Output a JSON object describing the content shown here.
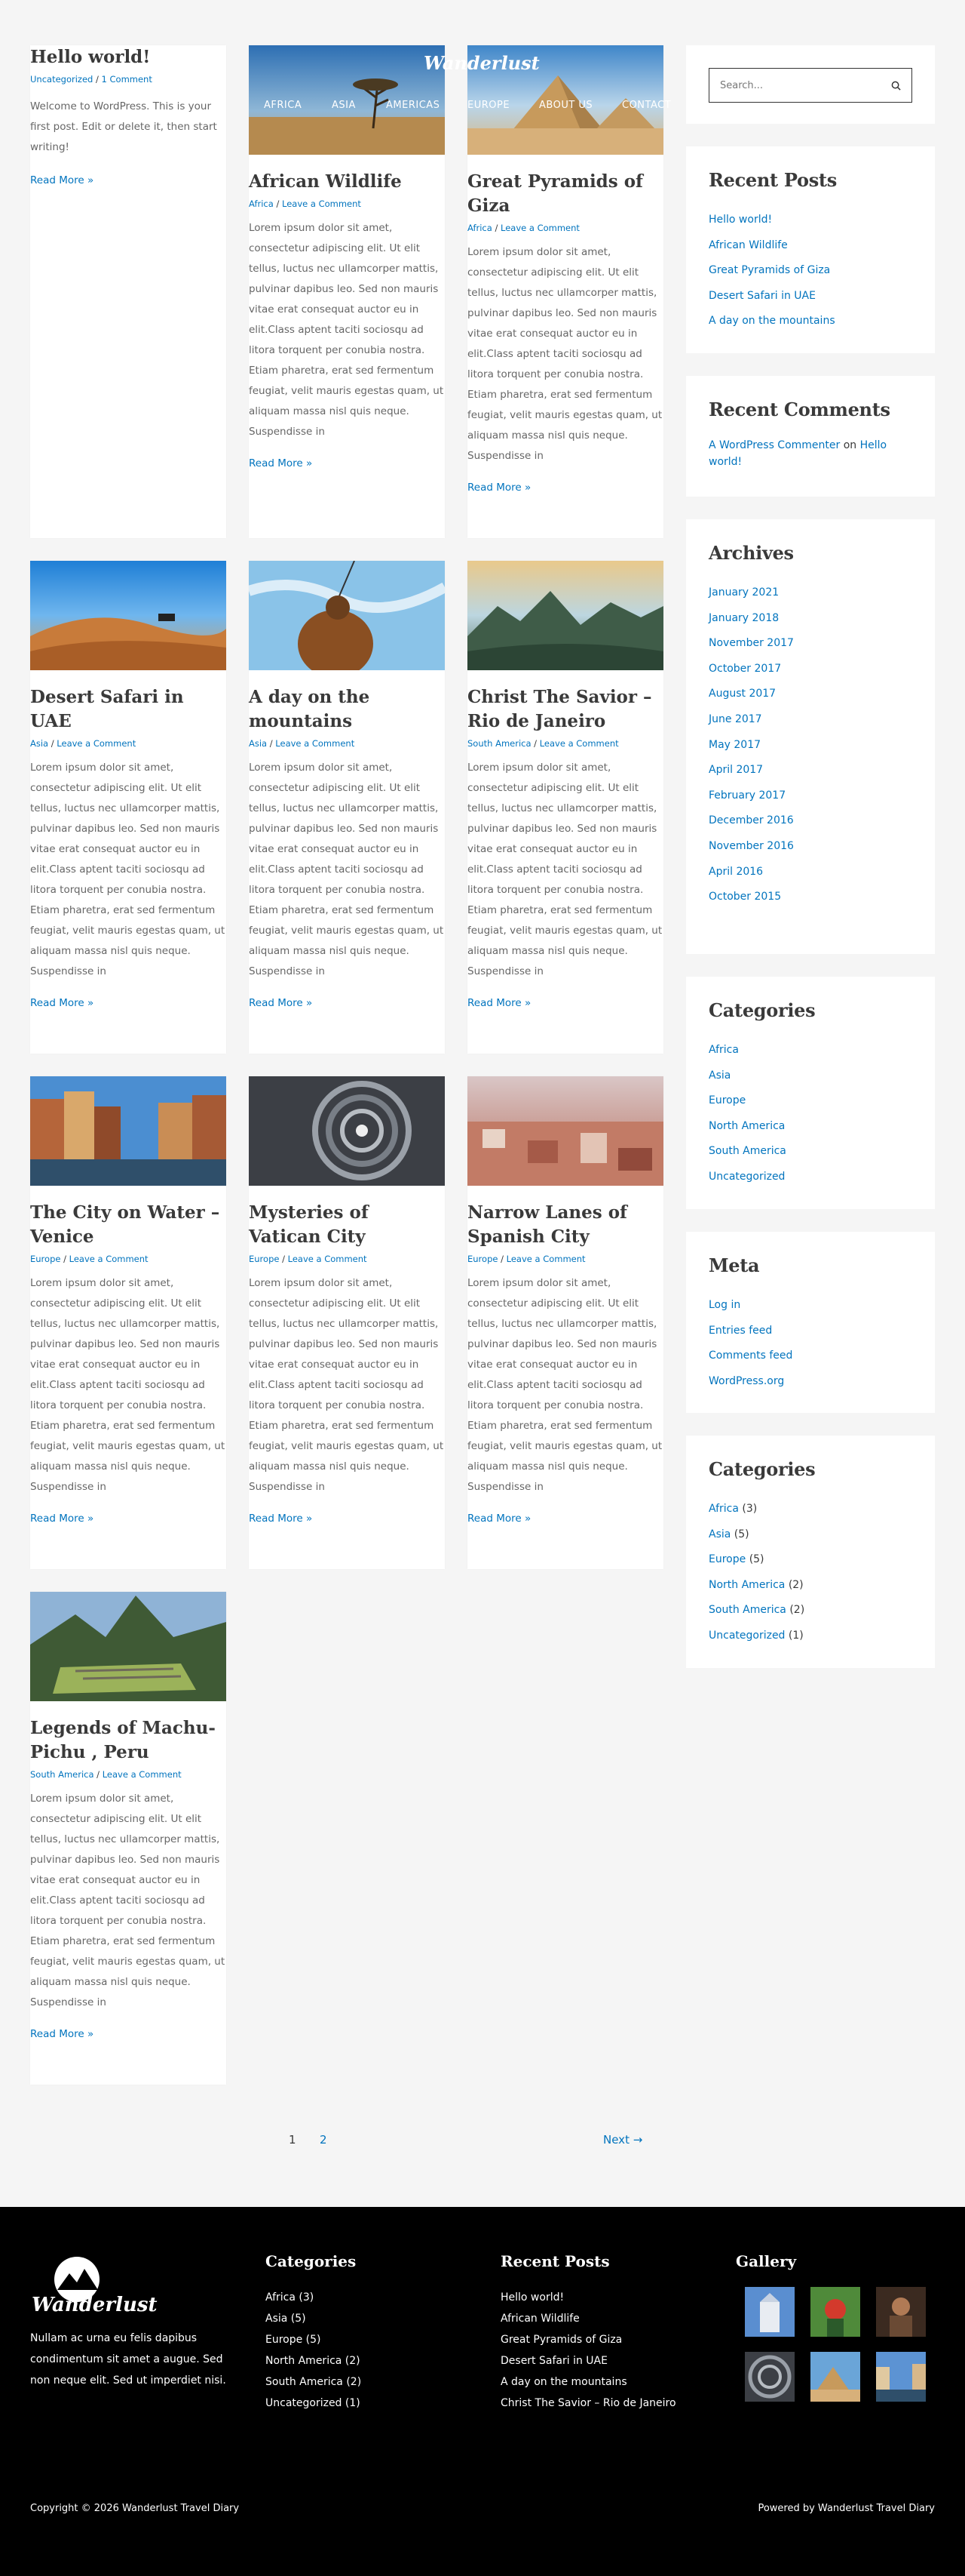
{
  "brand": {
    "logo_text": "Wanderlust"
  },
  "nav": {
    "items": [
      "AFRICA",
      "ASIA",
      "AMERICAS",
      "EUROPE",
      "ABOUT US",
      "CONTACT"
    ]
  },
  "posts": [
    {
      "title": "Hello world!",
      "categories": "Uncategorized",
      "comments": "1 Comment",
      "excerpt": "Welcome to WordPress. This is your first post. Edit or delete it, then start writing!",
      "more": "Read More »"
    },
    {
      "title": "African Wildlife",
      "categories": "Africa",
      "comments": "Leave a Comment",
      "excerpt": "Lorem ipsum dolor sit amet, consectetur adipiscing elit. Ut elit tellus, luctus nec ullamcorper mattis, pulvinar dapibus leo. Sed non mauris vitae erat consequat auctor eu in elit.Class aptent taciti sociosqu ad litora torquent per conubia nostra. Etiam pharetra, erat sed fermentum feugiat, velit mauris egestas quam, ut aliquam massa nisl quis neque. Suspendisse in",
      "more": "Read More »"
    },
    {
      "title": "Great Pyramids of Giza",
      "categories": "Africa",
      "comments": "Leave a Comment",
      "excerpt": "Lorem ipsum dolor sit amet, consectetur adipiscing elit. Ut elit tellus, luctus nec ullamcorper mattis, pulvinar dapibus leo. Sed non mauris vitae erat consequat auctor eu in elit.Class aptent taciti sociosqu ad litora torquent per conubia nostra. Etiam pharetra, erat sed fermentum feugiat, velit mauris egestas quam, ut aliquam massa nisl quis neque. Suspendisse in",
      "more": "Read More »"
    },
    {
      "title": "Desert Safari in UAE",
      "categories": "Asia",
      "comments": "Leave a Comment",
      "excerpt": "Lorem ipsum dolor sit amet, consectetur adipiscing elit. Ut elit tellus, luctus nec ullamcorper mattis, pulvinar dapibus leo. Sed non mauris vitae erat consequat auctor eu in elit.Class aptent taciti sociosqu ad litora torquent per conubia nostra. Etiam pharetra, erat sed fermentum feugiat, velit mauris egestas quam, ut aliquam massa nisl quis neque. Suspendisse in",
      "more": "Read More »"
    },
    {
      "title": "A day on the mountains",
      "categories": "Asia",
      "comments": "Leave a Comment",
      "excerpt": "Lorem ipsum dolor sit amet, consectetur adipiscing elit. Ut elit tellus, luctus nec ullamcorper mattis, pulvinar dapibus leo. Sed non mauris vitae erat consequat auctor eu in elit.Class aptent taciti sociosqu ad litora torquent per conubia nostra. Etiam pharetra, erat sed fermentum feugiat, velit mauris egestas quam, ut aliquam massa nisl quis neque. Suspendisse in",
      "more": "Read More »"
    },
    {
      "title": "Christ The Savior – Rio de Janeiro",
      "categories": "South America",
      "comments": "Leave a Comment",
      "excerpt": "Lorem ipsum dolor sit amet, consectetur adipiscing elit. Ut elit tellus, luctus nec ullamcorper mattis, pulvinar dapibus leo. Sed non mauris vitae erat consequat auctor eu in elit.Class aptent taciti sociosqu ad litora torquent per conubia nostra. Etiam pharetra, erat sed fermentum feugiat, velit mauris egestas quam, ut aliquam massa nisl quis neque. Suspendisse in",
      "more": "Read More »"
    },
    {
      "title": "The City on Water – Venice",
      "categories": "Europe",
      "comments": "Leave a Comment",
      "excerpt": "Lorem ipsum dolor sit amet, consectetur adipiscing elit. Ut elit tellus, luctus nec ullamcorper mattis, pulvinar dapibus leo. Sed non mauris vitae erat consequat auctor eu in elit.Class aptent taciti sociosqu ad litora torquent per conubia nostra. Etiam pharetra, erat sed fermentum feugiat, velit mauris egestas quam, ut aliquam massa nisl quis neque. Suspendisse in",
      "more": "Read More »"
    },
    {
      "title": "Mysteries of Vatican City",
      "categories": "Europe",
      "comments": "Leave a Comment",
      "excerpt": "Lorem ipsum dolor sit amet, consectetur adipiscing elit. Ut elit tellus, luctus nec ullamcorper mattis, pulvinar dapibus leo. Sed non mauris vitae erat consequat auctor eu in elit.Class aptent taciti sociosqu ad litora torquent per conubia nostra. Etiam pharetra, erat sed fermentum feugiat, velit mauris egestas quam, ut aliquam massa nisl quis neque. Suspendisse in",
      "more": "Read More »"
    },
    {
      "title": "Narrow Lanes of Spanish City",
      "categories": "Europe",
      "comments": "Leave a Comment",
      "excerpt": "Lorem ipsum dolor sit amet, consectetur adipiscing elit. Ut elit tellus, luctus nec ullamcorper mattis, pulvinar dapibus leo. Sed non mauris vitae erat consequat auctor eu in elit.Class aptent taciti sociosqu ad litora torquent per conubia nostra. Etiam pharetra, erat sed fermentum feugiat, velit mauris egestas quam, ut aliquam massa nisl quis neque. Suspendisse in",
      "more": "Read More »"
    },
    {
      "title": "Legends of Machu-Pichu , Peru",
      "categories": "South America",
      "comments": "Leave a Comment",
      "excerpt": "Lorem ipsum dolor sit amet, consectetur adipiscing elit. Ut elit tellus, luctus nec ullamcorper mattis, pulvinar dapibus leo. Sed non mauris vitae erat consequat auctor eu in elit.Class aptent taciti sociosqu ad litora torquent per conubia nostra. Etiam pharetra, erat sed fermentum feugiat, velit mauris egestas quam, ut aliquam massa nisl quis neque. Suspendisse in",
      "more": "Read More »"
    }
  ],
  "sidebar": {
    "search": {
      "placeholder": "Search..."
    },
    "recent_posts": {
      "title": "Recent Posts",
      "items": [
        "Hello world!",
        "African Wildlife",
        "Great Pyramids of Giza",
        "Desert Safari in UAE",
        "A day on the mountains"
      ]
    },
    "recent_comments": {
      "title": "Recent Comments",
      "author": "A WordPress Commenter",
      "on": "on",
      "post": "Hello world!"
    },
    "archives": {
      "title": "Archives",
      "items": [
        "January 2021",
        "January 2018",
        "November 2017",
        "October 2017",
        "August 2017",
        "June 2017",
        "May 2017",
        "April 2017",
        "February 2017",
        "December 2016",
        "November 2016",
        "April 2016",
        "October 2015"
      ]
    },
    "categories": {
      "title": "Categories",
      "items": [
        "Africa",
        "Asia",
        "Europe",
        "North America",
        "South America",
        "Uncategorized"
      ]
    },
    "meta": {
      "title": "Meta",
      "items": [
        "Log in",
        "Entries feed",
        "Comments feed",
        "WordPress.org"
      ]
    },
    "categories_counts": {
      "title": "Categories",
      "items": [
        {
          "name": "Africa",
          "count": "(3)"
        },
        {
          "name": "Asia",
          "count": "(5)"
        },
        {
          "name": "Europe",
          "count": "(5)"
        },
        {
          "name": "North America",
          "count": "(2)"
        },
        {
          "name": "South America",
          "count": "(2)"
        },
        {
          "name": "Uncategorized",
          "count": "(1)"
        }
      ]
    }
  },
  "pagination": {
    "page1": "1",
    "page2": "2",
    "next": "Next →"
  },
  "footer": {
    "about": "Nullam ac urna eu felis dapibus condimentum sit amet a augue. Sed non neque elit. Sed ut imperdiet nisi.",
    "categories": {
      "title": "Categories",
      "items": [
        "Africa (3)",
        "Asia (5)",
        "Europe (5)",
        "North America (2)",
        "South America (2)",
        "Uncategorized (1)"
      ]
    },
    "recent_posts": {
      "title": "Recent Posts",
      "items": [
        "Hello world!",
        "African Wildlife",
        "Great Pyramids of Giza",
        "Desert Safari in UAE",
        "A day on the mountains",
        "Christ The Savior – Rio de Janeiro"
      ]
    },
    "gallery": {
      "title": "Gallery"
    },
    "copyright": "Copyright © 2026 Wanderlust Travel Diary",
    "powered": "Powered by Wanderlust Travel Diary"
  },
  "colors": {
    "link": "#0274be",
    "bg": "#f5f5f5",
    "footer_bg": "#000000"
  }
}
